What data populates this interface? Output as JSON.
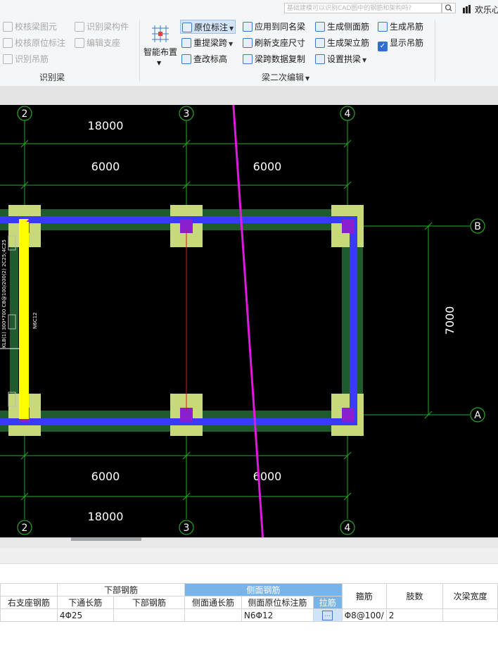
{
  "app": {
    "search_placeholder": "基础建模可以识别CAD图中的钢筋和架构吗?",
    "user_name": "欢乐心"
  },
  "ribbon": {
    "recognize_group": {
      "label": "识别梁",
      "items": [
        "校核梁图元",
        "识别梁构件",
        "校核原位标注",
        "编辑支座",
        "识别吊筋"
      ]
    },
    "secondary_group": {
      "label": "梁二次编辑",
      "smart_layout": "智能布置",
      "items": [
        "原位标注",
        "应用到同名梁",
        "生成侧面筋",
        "生成吊筋",
        "重提梁跨",
        "刷新支座尺寸",
        "生成架立筋",
        "显示吊筋",
        "查改标高",
        "梁跨数据复制",
        "设置拱梁"
      ]
    }
  },
  "canvas": {
    "axes_top": [
      "2",
      "3",
      "4"
    ],
    "axes_bottom": [
      "2",
      "3",
      "4"
    ],
    "axes_right": [
      "B",
      "A"
    ],
    "dim_top_total": "18000",
    "dim_top_spans": [
      "6000",
      "6000"
    ],
    "dim_bottom_spans": [
      "6000",
      "6000"
    ],
    "dim_bottom_total": "18000",
    "dim_right": "7000",
    "beam_text_left": "KL8(1) 300*700 C8@100/200(2) 2C25;4C25",
    "beam_text_left2": "N6C12"
  },
  "table": {
    "group_headers": [
      "下部钢筋",
      "侧面钢筋"
    ],
    "columns": [
      "右支座钢筋",
      "下通长筋",
      "下部钢筋",
      "侧面通长筋",
      "侧面原位标注筋",
      "拉筋",
      "箍筋",
      "肢数",
      "次梁宽度"
    ],
    "row": [
      "",
      "4Φ25",
      "",
      "",
      "N6Φ12",
      "",
      "Φ8@100/",
      "2",
      ""
    ]
  },
  "colors": {
    "canvas_bg": "#000000",
    "beam_blue": "#3a3aff",
    "beam_green": "#1f5c2d",
    "column_fill": "#c8d97a",
    "column_core": "#8a1fd0",
    "grid_line": "#27a827",
    "highlight_beam": "#ffff00",
    "arrow": "#e019e0",
    "table_header_active": "#78b4e8"
  }
}
